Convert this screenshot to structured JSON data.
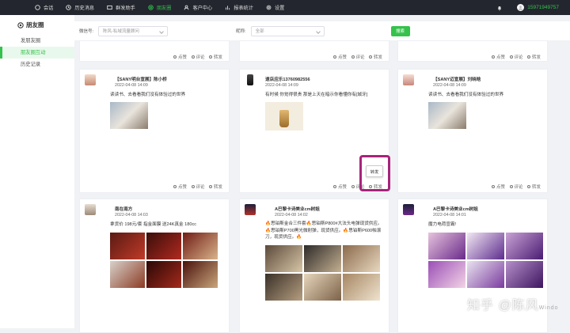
{
  "nav": {
    "items": [
      {
        "label": "会话",
        "icon": "chat-icon"
      },
      {
        "label": "历史消息",
        "icon": "history-icon"
      },
      {
        "label": "群发助手",
        "icon": "broadcast-icon"
      },
      {
        "label": "朋友圈",
        "icon": "moments-icon",
        "active": true
      },
      {
        "label": "客户中心",
        "icon": "user-icon"
      },
      {
        "label": "报表统计",
        "icon": "chart-icon"
      },
      {
        "label": "设置",
        "icon": "gear-icon"
      }
    ],
    "phone": "15971949757"
  },
  "sidebar": {
    "title": "朋友圈",
    "items": [
      {
        "label": "发朋友圈"
      },
      {
        "label": "朋友圈互动",
        "active": true
      },
      {
        "label": "历史记录"
      }
    ]
  },
  "filter": {
    "wechat_label": "微信号:",
    "wechat_value": "陈风-私域流量顾问",
    "name_label": "昵称:",
    "name_value": "全部",
    "search": "搜索"
  },
  "actions": {
    "like": "点赞",
    "comment": "评论",
    "forward": "转发"
  },
  "tooltip": "转发",
  "posts": [
    {
      "name": "【SANY明台宣展】陈小桥",
      "time": "2022-04-08 14:09",
      "text": "读读书、去看看我们没有体验过的世界"
    },
    {
      "name": "速店应乐13760982556",
      "time": "2022-04-08 14:09",
      "text": "有时候 你觉得很贵 那是上天在暗示你看懂你有[城牙]"
    },
    {
      "name": "【SANY迈宣展】刘晓晗",
      "time": "2022-04-08 14:09",
      "text": "读读书、去看看我们没有体验过的世界"
    },
    {
      "name": "南在南方",
      "time": "2022-04-08 14:03",
      "text": "拿货价 198元/套 指金面膜 送24K真金 180cc"
    },
    {
      "name": "A巴黎卡诗美业cm树姐",
      "time": "2022-04-08 14:02",
      "text": "🔥思铂斯金合三件套🔥思铂斯P800#大法头电弹现货供应。🔥思铂斯P700黑光微射弹，现货供应。🔥思铂斯P600帕滚刀，现货供应。🔥"
    },
    {
      "name": "A巴黎卡诗美业cm树姐",
      "time": "2022-04-08 14:01",
      "text": "魔力电荷宣霸!"
    }
  ],
  "watermark": {
    "text": "知乎 @陈风",
    "sub": "Windo"
  }
}
